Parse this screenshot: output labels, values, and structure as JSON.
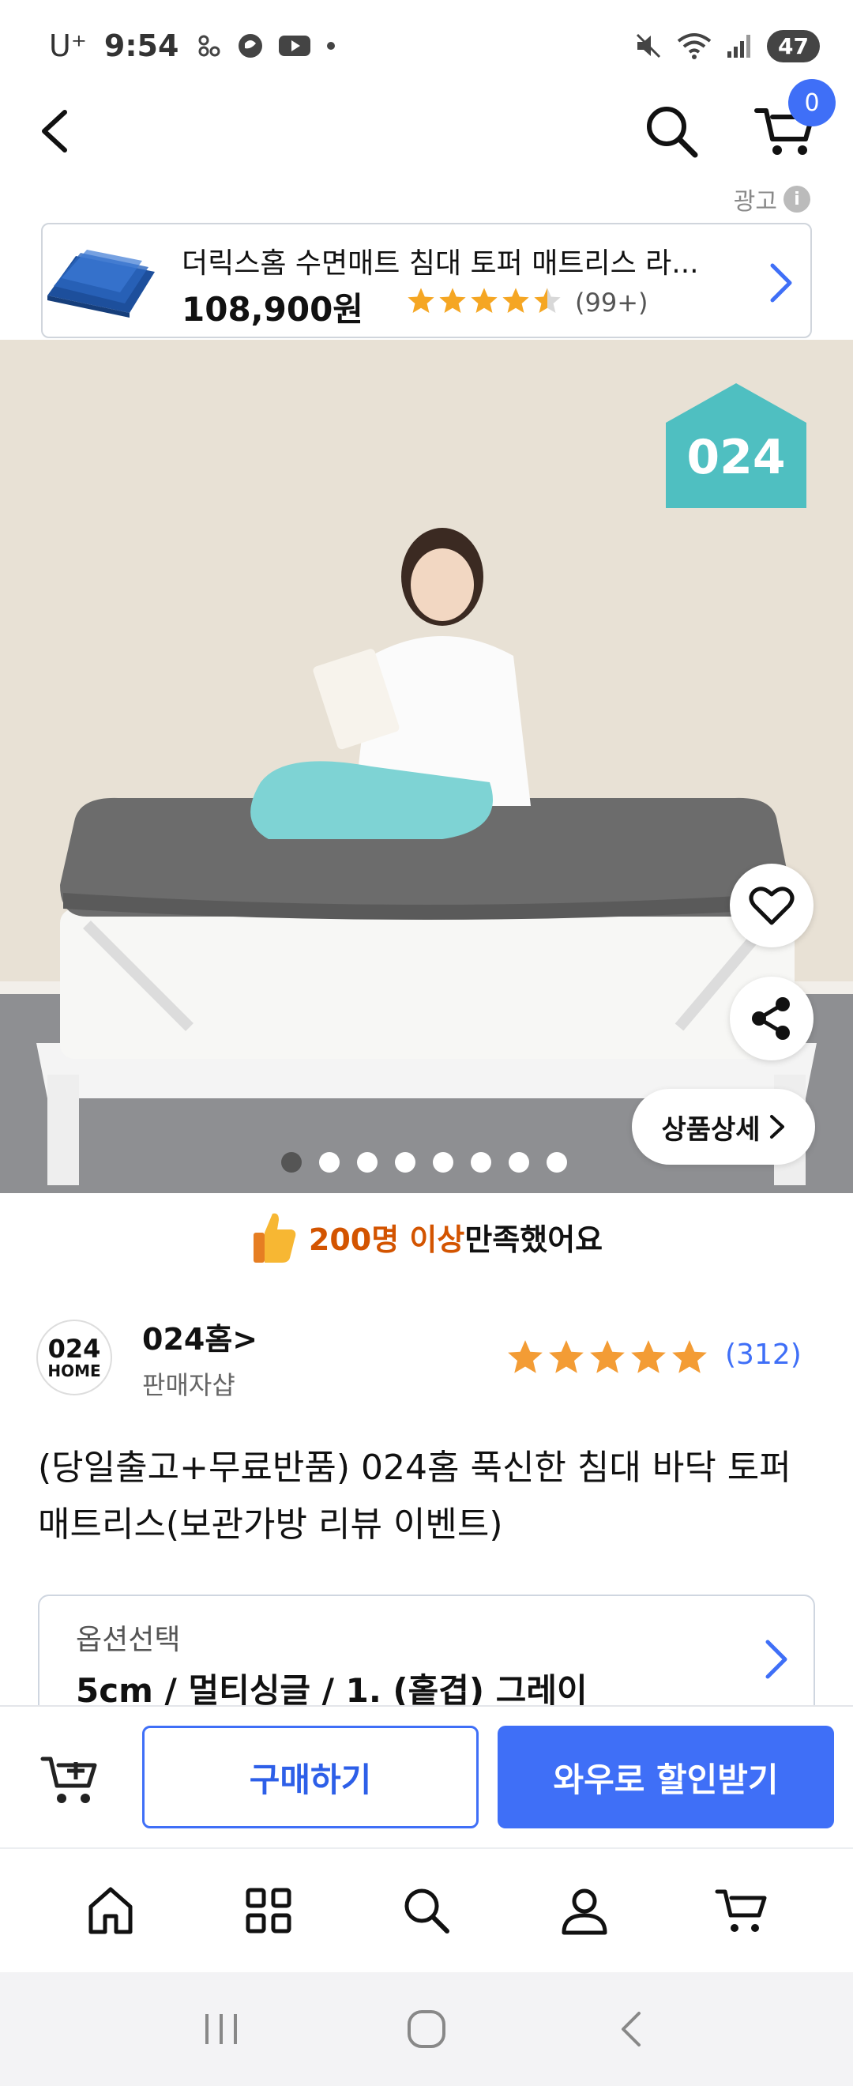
{
  "status_bar": {
    "carrier": "U⁺",
    "time": "9:54",
    "battery": "47"
  },
  "header": {
    "cart_count": "0"
  },
  "ad": {
    "label": "광고",
    "info_icon": "i",
    "title": "더릭스홈 수면매트 침대 토퍼 매트리스 라...",
    "price": "108,900원",
    "rating": 4.5,
    "review_count": "(99+)"
  },
  "hero": {
    "brand_badge": "024",
    "detail_label": "상품상세",
    "slide_count": 8,
    "active_slide": 1
  },
  "satisfaction": {
    "highlight": "200명 이상",
    "rest": " 만족했어요"
  },
  "seller": {
    "logo_line1": "024",
    "logo_line2": "HOME",
    "name": "024홈",
    "chevron": ">",
    "type": "판매자샵",
    "rating": 5,
    "review_count": "(312)"
  },
  "product": {
    "title": "(당일출고+무료반품) 024홈 푹신한 침대 바닥 토퍼 매트리스(보관가방 리뷰 이벤트)"
  },
  "option": {
    "label": "옵션선택",
    "value": "5cm / 멀티싱글 / 1. (홑겹) 그레이"
  },
  "actions": {
    "buy_label": "구매하기",
    "wow_label": "와우로 할인받기"
  },
  "tabs": [
    {
      "icon": "home-icon"
    },
    {
      "icon": "category-grid-icon"
    },
    {
      "icon": "search-icon"
    },
    {
      "icon": "profile-icon"
    },
    {
      "icon": "cart-icon"
    }
  ],
  "colors": {
    "accent": "#3f6ff7",
    "star": "#f5a623",
    "highlight": "#d35400",
    "brand_badge": "#4fbfc1"
  }
}
